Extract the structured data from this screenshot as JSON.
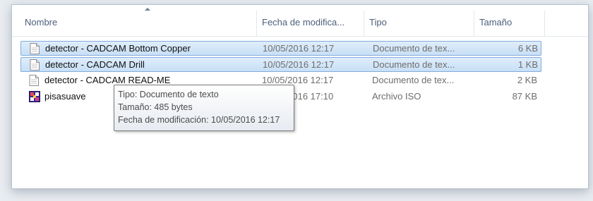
{
  "columns": {
    "name": "Nombre",
    "date": "Fecha de modifica...",
    "type": "Tipo",
    "size": "Tamaño"
  },
  "files": [
    {
      "name": "detector - CADCAM Bottom Copper",
      "date": "10/05/2016 12:17",
      "type": "Documento de tex...",
      "size": "6 KB",
      "icon": "text-document-icon",
      "selected": true
    },
    {
      "name": "detector - CADCAM Drill",
      "date": "10/05/2016 12:17",
      "type": "Documento de tex...",
      "size": "1 KB",
      "icon": "text-document-icon",
      "selected": true
    },
    {
      "name": "detector - CADCAM READ-ME",
      "date": "10/05/2016 12:17",
      "type": "Documento de tex...",
      "size": "2 KB",
      "icon": "text-document-icon",
      "selected": false
    },
    {
      "name": "pisasuave",
      "date": "10/05/2016 17:10",
      "type": "Archivo ISO",
      "size": "87 KB",
      "icon": "iso-file-icon",
      "selected": false
    }
  ],
  "tooltip": {
    "type": "Tipo: Documento de texto",
    "size": "Tamaño: 485 bytes",
    "modified": "Fecha de modificación: 10/05/2016 12:17"
  },
  "colors": {
    "selection_fill": "#cde3f8",
    "selection_border": "#84acdd",
    "header_text": "#4c607a"
  }
}
